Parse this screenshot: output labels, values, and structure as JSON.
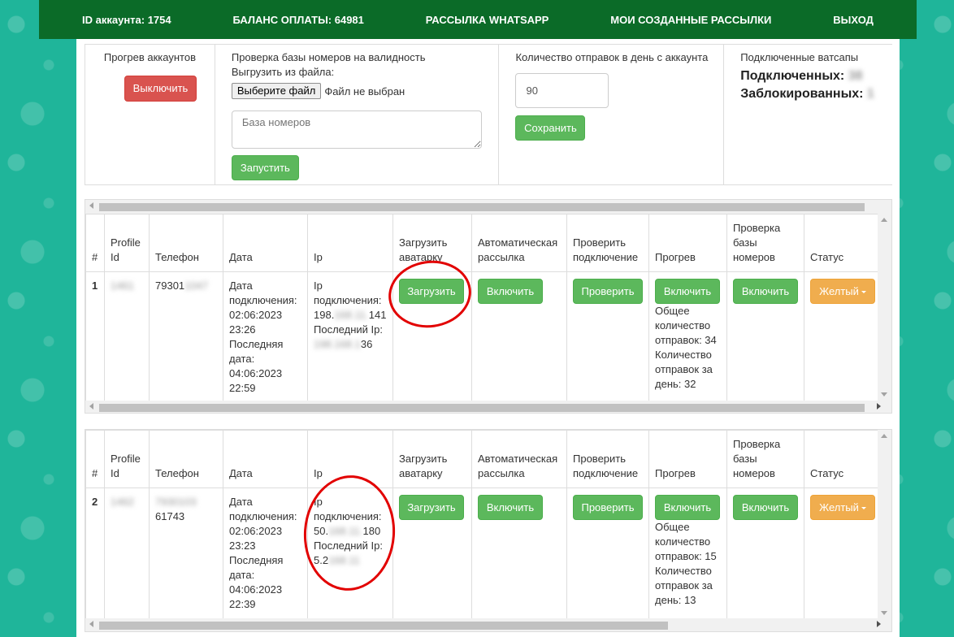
{
  "navbar": {
    "account_id": "ID аккаунта: 1754",
    "balance": "БАЛАНС ОПЛАТЫ: 64981",
    "whatsapp_mailing": "РАССЫЛКА WHATSAPP",
    "my_mailings": "МОИ СОЗДАННЫЕ РАССЫЛКИ",
    "logout": "ВЫХОД"
  },
  "settings": {
    "warmup": {
      "title": "Прогрев аккаунтов",
      "button": "Выключить"
    },
    "validation": {
      "title": "Проверка базы номеров на валидность",
      "upload_label": "Выгрузить из файла:",
      "file_button": "Выберите файл",
      "file_status": "Файл не выбран",
      "textarea_placeholder": "База номеров",
      "run_button": "Запустить"
    },
    "daily_limit": {
      "title": "Количество отправок в день с аккаунта",
      "value": "90",
      "save_button": "Сохранить"
    },
    "connected": {
      "title": "Подключенные ватсапы",
      "connected_label": "Подключенных:",
      "connected_value": "38",
      "blocked_label": "Заблокированных:",
      "blocked_value": "1"
    }
  },
  "table_headers": {
    "num": "#",
    "profile_id": "Profile Id",
    "phone": "Телефон",
    "date": "Дата",
    "ip": "Ip",
    "avatar": "Загрузить аватарку",
    "auto_mailing": "Автоматическая рассылка",
    "check_conn": "Проверить подключение",
    "warmup": "Прогрев",
    "check_base": "Проверка базы номеров",
    "status": "Статус"
  },
  "accounts": [
    {
      "num": "1",
      "profile_id": "1461",
      "phone_visible": "79301",
      "phone_blurred": "1047",
      "date_text": "Дата подключения: 02:06:2023 23:26 Последняя дата: 04:06:2023 22:59",
      "ip_label_1": "Ip подключения:",
      "ip1_start": "198.",
      "ip1_blur": "168.11.",
      "ip1_end": "141",
      "ip_label_2": "Последний Ip:",
      "ip2_blur": "198.168.1",
      "ip2_end": "36",
      "avatar_button": "Загрузить",
      "auto_button": "Включить",
      "check_button": "Проверить",
      "warmup_button": "Включить",
      "warmup_stats": "Общее количество отправок: 34 Количество отправок за день: 32",
      "base_button": "Включить",
      "status": "Желтый"
    },
    {
      "num": "2",
      "profile_id": "1462",
      "phone_visible": "61743",
      "phone_blurred": "7930103",
      "date_text": "Дата подключения: 02:06:2023 23:23 Последняя дата: 04:06:2023 22:39",
      "ip_label_1": "Ip подключения:",
      "ip1_start": "50.",
      "ip1_blur": "168.11.",
      "ip1_end": "180",
      "ip_label_2": "Последний Ip:",
      "ip2_start": "5.2",
      "ip2_blur": "168.11",
      "avatar_button": "Загрузить",
      "auto_button": "Включить",
      "check_button": "Проверить",
      "warmup_button": "Включить",
      "warmup_stats": "Общее количество отправок: 15 Количество отправок за день: 13",
      "base_button": "Включить",
      "status": "Желтый"
    }
  ],
  "colors": {
    "navbar": "#0b6b28",
    "background": "#1fb59a",
    "danger": "#d9534f",
    "success": "#5cb85c",
    "warning": "#f0ad4e",
    "annotation": "#e20000"
  }
}
